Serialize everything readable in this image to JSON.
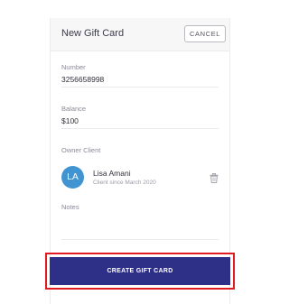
{
  "header": {
    "title": "New Gift Card",
    "cancel_label": "CANCEL"
  },
  "fields": {
    "number": {
      "label": "Number",
      "value": "3256658998"
    },
    "balance": {
      "label": "Balance",
      "value": "$100"
    },
    "owner": {
      "label": "Owner Client"
    },
    "notes": {
      "label": "Notes",
      "value": ""
    }
  },
  "client": {
    "initials": "LA",
    "name": "Lisa Amani",
    "subtitle": "Client since March 2020",
    "avatar_color": "#4194d2",
    "remove_icon": "trash-icon"
  },
  "footer": {
    "create_label": "CREATE GIFT CARD",
    "button_color": "#2e2f86",
    "highlight_color": "#e01b24"
  }
}
